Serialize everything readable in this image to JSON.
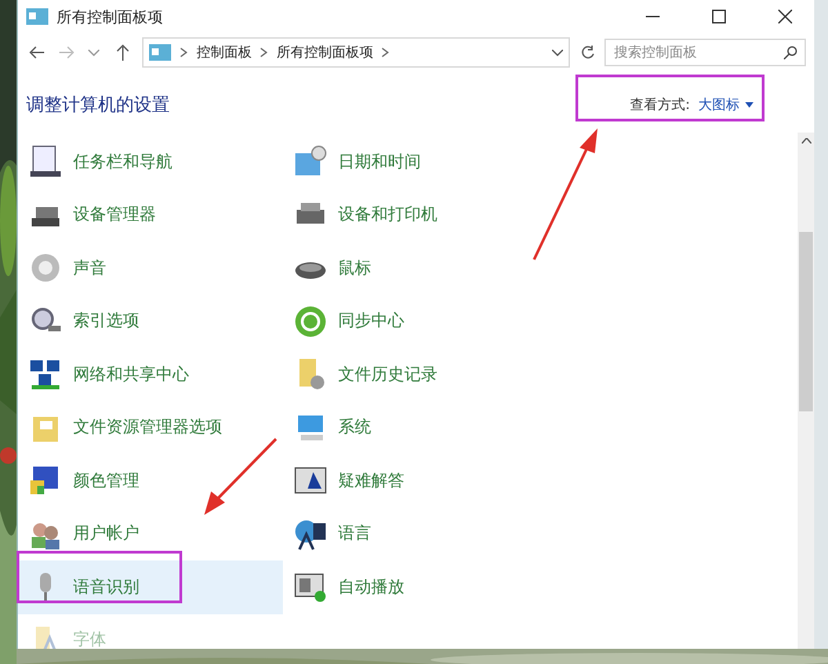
{
  "window": {
    "title": "所有控制面板项"
  },
  "address_bar": {
    "breadcrumb": [
      "控制面板",
      "所有控制面板项"
    ]
  },
  "search": {
    "placeholder": "搜索控制面板"
  },
  "heading": "调整计算机的设置",
  "view_by": {
    "label": "查看方式:",
    "value": "大图标"
  },
  "items": [
    {
      "label": "任务栏和导航",
      "selected": false,
      "dimmed": false
    },
    {
      "label": "日期和时间",
      "selected": false,
      "dimmed": false
    },
    {
      "label": "设备管理器",
      "selected": false,
      "dimmed": false
    },
    {
      "label": "设备和打印机",
      "selected": false,
      "dimmed": false
    },
    {
      "label": "声音",
      "selected": false,
      "dimmed": false
    },
    {
      "label": "鼠标",
      "selected": false,
      "dimmed": false
    },
    {
      "label": "索引选项",
      "selected": false,
      "dimmed": false
    },
    {
      "label": "同步中心",
      "selected": false,
      "dimmed": false
    },
    {
      "label": "网络和共享中心",
      "selected": false,
      "dimmed": false
    },
    {
      "label": "文件历史记录",
      "selected": false,
      "dimmed": false
    },
    {
      "label": "文件资源管理器选项",
      "selected": false,
      "dimmed": false
    },
    {
      "label": "系统",
      "selected": false,
      "dimmed": false
    },
    {
      "label": "颜色管理",
      "selected": false,
      "dimmed": false
    },
    {
      "label": "疑难解答",
      "selected": false,
      "dimmed": false
    },
    {
      "label": "用户帐户",
      "selected": false,
      "dimmed": false
    },
    {
      "label": "语言",
      "selected": false,
      "dimmed": false
    },
    {
      "label": "语音识别",
      "selected": true,
      "dimmed": false
    },
    {
      "label": "自动播放",
      "selected": false,
      "dimmed": false
    },
    {
      "label": "字体",
      "selected": false,
      "dimmed": true
    }
  ]
}
